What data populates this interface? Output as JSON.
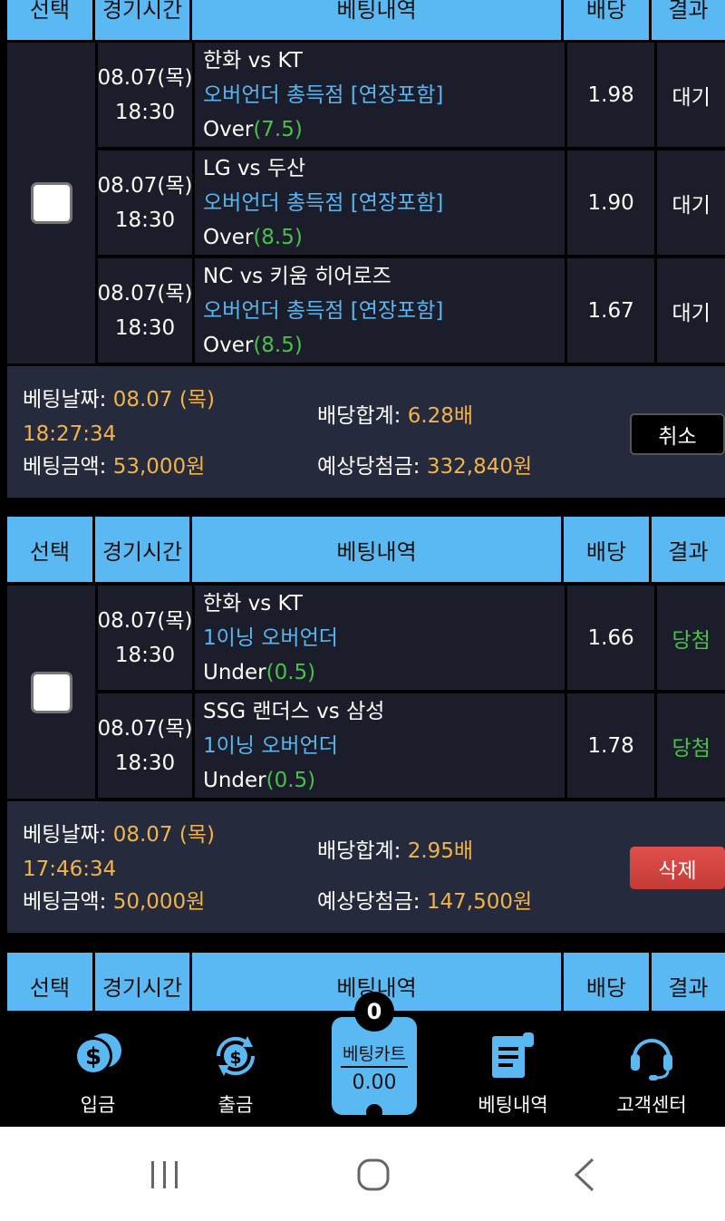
{
  "table_header": {
    "select": "선택",
    "time": "경기시간",
    "details": "베팅내역",
    "odds": "배당",
    "result": "결과"
  },
  "summary_labels": {
    "bet_date": "베팅날짜:",
    "bet_amount": "베팅금액:",
    "total_odds": "배당합계:",
    "expected_payout": "예상당첨금:"
  },
  "slips": [
    {
      "rows": [
        {
          "date": "08.07(목)",
          "time": "18:30",
          "match": "한화 vs KT",
          "market": "오버언더 총득점 [연장포함]",
          "pick": "Over",
          "pick_value": "(7.5)",
          "odds": "1.98",
          "result": "대기"
        },
        {
          "date": "08.07(목)",
          "time": "18:30",
          "match": "LG vs 두산",
          "market": "오버언더 총득점 [연장포함]",
          "pick": "Over",
          "pick_value": "(8.5)",
          "odds": "1.90",
          "result": "대기"
        },
        {
          "date": "08.07(목)",
          "time": "18:30",
          "match": "NC vs 키움 히어로즈",
          "market": "오버언더 총득점 [연장포함]",
          "pick": "Over",
          "pick_value": "(8.5)",
          "odds": "1.67",
          "result": "대기"
        }
      ],
      "bet_date": "08.07 (목)",
      "bet_time": "18:27:34",
      "bet_amount": "53,000원",
      "total_odds": "6.28배",
      "expected_payout": "332,840원",
      "action_label": "취소"
    },
    {
      "rows": [
        {
          "date": "08.07(목)",
          "time": "18:30",
          "match": "한화 vs KT",
          "market": "1이닝 오버언더",
          "pick": "Under",
          "pick_value": "(0.5)",
          "odds": "1.66",
          "result": "당첨"
        },
        {
          "date": "08.07(목)",
          "time": "18:30",
          "match": "SSG 랜더스 vs 삼성",
          "market": "1이닝 오버언더",
          "pick": "Under",
          "pick_value": "(0.5)",
          "odds": "1.78",
          "result": "당첨"
        }
      ],
      "bet_date": "08.07 (목)",
      "bet_time": "17:46:34",
      "bet_amount": "50,000원",
      "total_odds": "2.95배",
      "expected_payout": "147,500원",
      "action_label": "삭제"
    }
  ],
  "bottom_nav": {
    "deposit": "입금",
    "withdraw": "출금",
    "bet_history": "베팅내역",
    "customer_center": "고객센터"
  },
  "bet_cart": {
    "label": "베팅카트",
    "count": "0",
    "total": "0.00"
  },
  "colors": {
    "header_blue": "#5ab9f3",
    "market_blue": "#58b6f0",
    "win_green": "#47c14a",
    "gold": "#f2b447",
    "delete_red": "#d4443f"
  },
  "icons": [
    "coins-icon",
    "money-cycle-icon",
    "receipt-icon",
    "headset-icon"
  ]
}
